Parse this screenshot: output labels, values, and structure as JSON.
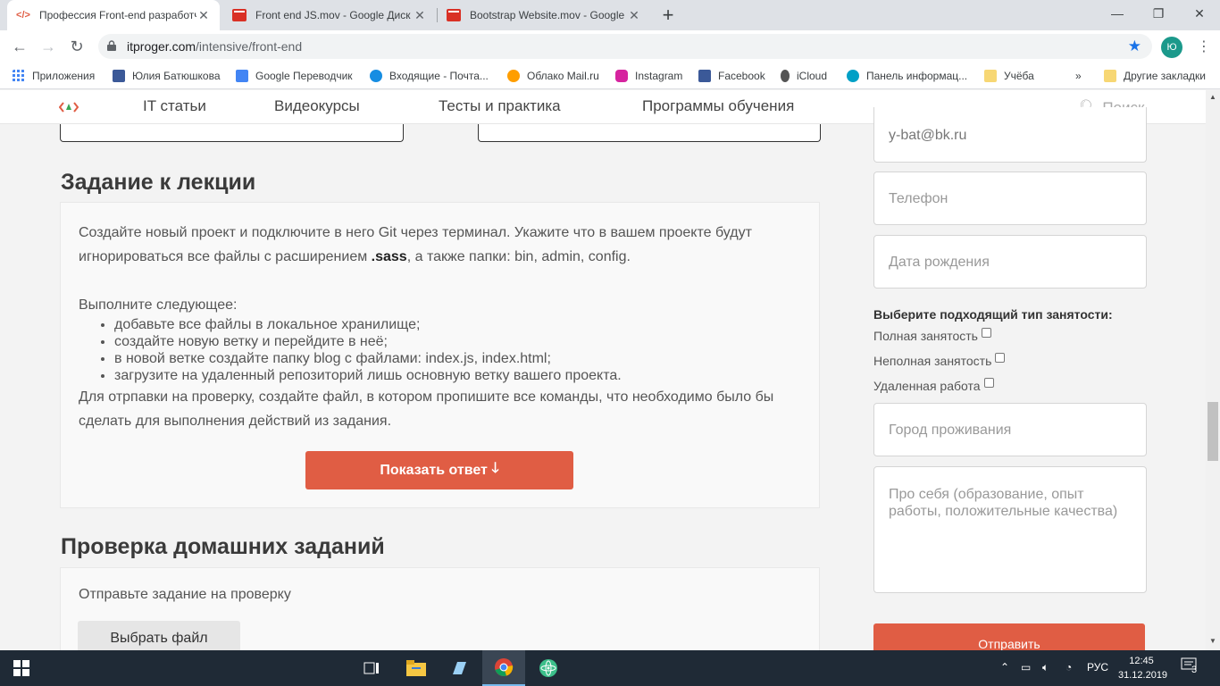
{
  "browser": {
    "tabs": [
      {
        "title": "Профессия Front-end разработчик",
        "active": true
      },
      {
        "title": "Front end JS.mov - Google Диск",
        "active": false
      },
      {
        "title": "Bootstrap Website.mov - Google",
        "active": false
      }
    ],
    "url_host": "itproger.com",
    "url_path": "/intensive/front-end",
    "profile_initial": "Ю"
  },
  "bookmarks": [
    {
      "label": "Приложения",
      "icon": "apps-grid-icon",
      "color": "#4285f4"
    },
    {
      "label": "Юлия Батюшкова",
      "icon": "chat-icon",
      "color": "#3b5998"
    },
    {
      "label": "Google Переводчик",
      "icon": "translate-icon",
      "color": "#4285f4"
    },
    {
      "label": "Входящие - Почта...",
      "icon": "mail-icon",
      "color": "#168de2"
    },
    {
      "label": "Облако Mail.ru",
      "icon": "cloud-icon",
      "color": "#ff9e00"
    },
    {
      "label": "Instagram",
      "icon": "instagram-icon",
      "color": "#d6249f"
    },
    {
      "label": "Facebook",
      "icon": "facebook-icon",
      "color": "#3b5998"
    },
    {
      "label": "iCloud",
      "icon": "apple-icon",
      "color": "#555555"
    },
    {
      "label": "Панель информац...",
      "icon": "panel-icon",
      "color": "#00a0c6"
    },
    {
      "label": "Учёба",
      "icon": "folder-icon",
      "color": "#f7d774"
    }
  ],
  "other_bookmarks": "Другие закладки",
  "site_nav": {
    "items": [
      "IT статьи",
      "Видеокурсы",
      "Тесты и практика",
      "Программы обучения"
    ],
    "search": "Поиск"
  },
  "lecture": {
    "heading": "Задание к лекции",
    "intro_part1": "Создайте новый проект и подключите в него Git через терминал. Укажите что в вашем проекте будут игнорироваться все файлы с расширением ",
    "intro_bold": ".sass",
    "intro_part2": ", а также папки: bin, admin, config.",
    "todo_label": "Выполните следующее:",
    "tasks": [
      "добавьте все файлы в локальное хранилище;",
      "создайте новую ветку и перейдите в неё;",
      "в новой ветке создайте папку blog с файлами: index.js, index.html;",
      "загрузите на удаленный репозиторий лишь основную ветку вашего проекта."
    ],
    "outro": "Для отрпавки на проверку, создайте файл, в котором пропишите все команды, что необходимо было бы сделать для выполнения действий из задания.",
    "show_answer": "Показать ответ"
  },
  "homework": {
    "heading": "Проверка домашних заданий",
    "prompt": "Отправьте задание на проверку",
    "file_button": "Выбрать файл"
  },
  "form": {
    "email_value": "y-bat@bk.ru",
    "phone_placeholder": "Телефон",
    "birthdate_placeholder": "Дата рождения",
    "employment_question": "Выберите подходящий тип занятости:",
    "employment_options": [
      "Полная занятость",
      "Неполная занятость",
      "Удаленная работа"
    ],
    "city_placeholder": "Город проживания",
    "about_placeholder": "Про себя (образование, опыт работы, положительные качества)",
    "submit": "Отправить"
  },
  "taskbar": {
    "lang": "РУС",
    "time": "12:45",
    "date": "31.12.2019",
    "notifications": "3"
  },
  "colors": {
    "accent": "#e05d44",
    "taskbar": "#1f2a36"
  }
}
